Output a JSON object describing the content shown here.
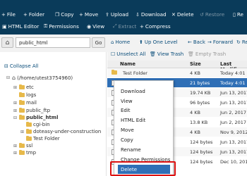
{
  "toolbar": {
    "row1": [
      {
        "icon": "plus-icon",
        "glyph": "+",
        "label": "File",
        "enabled": true
      },
      {
        "icon": "plus-icon",
        "glyph": "+",
        "label": "Folder",
        "enabled": true
      },
      {
        "icon": "copy-icon",
        "glyph": "❐",
        "label": "Copy",
        "enabled": true
      },
      {
        "icon": "move-icon",
        "glyph": "+",
        "label": "Move",
        "enabled": true
      },
      {
        "icon": "upload-icon",
        "glyph": "⇪",
        "label": "Upload",
        "enabled": true
      },
      {
        "icon": "download-icon",
        "glyph": "⇩",
        "label": "Download",
        "enabled": true
      },
      {
        "icon": "delete-icon",
        "glyph": "✕",
        "label": "Delete",
        "enabled": true
      },
      {
        "icon": "restore-icon",
        "glyph": "↺",
        "label": "Restore",
        "enabled": false
      },
      {
        "icon": "rename-icon",
        "glyph": "▯",
        "label": "Re",
        "enabled": true
      }
    ],
    "row2": [
      {
        "icon": "html-editor-icon",
        "glyph": "▣",
        "label": "HTML Editor",
        "enabled": true
      },
      {
        "icon": "key-icon",
        "glyph": "⚿",
        "label": "Permissions",
        "enabled": true
      },
      {
        "icon": "eye-icon",
        "glyph": "◉",
        "label": "View",
        "enabled": true
      },
      {
        "icon": "extract-icon",
        "glyph": "⤢",
        "label": "Extract",
        "enabled": false
      },
      {
        "icon": "compress-icon",
        "glyph": "+",
        "label": "Compress",
        "enabled": true
      }
    ]
  },
  "pathbar": {
    "path_value": "public_html",
    "go_label": "Go"
  },
  "right_toolbar": {
    "row1": [
      {
        "icon": "home-icon",
        "glyph": "⌂",
        "label": "Home",
        "enabled": true
      },
      {
        "icon": "up-level-icon",
        "glyph": "⬆",
        "label": "Up One Level",
        "enabled": true
      },
      {
        "icon": "back-icon",
        "glyph": "←",
        "label": "Back",
        "enabled": true
      },
      {
        "icon": "forward-icon",
        "glyph": "→",
        "label": "Forward",
        "enabled": true
      },
      {
        "icon": "reload-icon",
        "glyph": "↻",
        "label": "Re",
        "enabled": true
      }
    ],
    "row2": [
      {
        "icon": "unselect-icon",
        "glyph": "☐",
        "label": "Unselect All",
        "enabled": true
      },
      {
        "icon": "trash-icon",
        "glyph": "🗑",
        "label": "View Trash",
        "enabled": true
      },
      {
        "icon": "empty-trash-icon",
        "glyph": "🗑",
        "label": "Empty Trash",
        "enabled": false
      }
    ]
  },
  "sidebar": {
    "collapse_label": "Collapse All",
    "root_label": "(/home/utest3754960)",
    "items": [
      {
        "label": "etc",
        "toggle": "+",
        "bold": false
      },
      {
        "label": "logs",
        "toggle": "",
        "bold": false
      },
      {
        "label": "mail",
        "toggle": "+",
        "bold": false
      },
      {
        "label": "public_ftp",
        "toggle": "+",
        "bold": false
      },
      {
        "label": "public_html",
        "toggle": "−",
        "bold": true
      },
      {
        "label": "cgi-bin",
        "toggle": "",
        "bold": false
      },
      {
        "label": "doteasy-under-construction",
        "toggle": "+",
        "bold": false
      },
      {
        "label": "Test Folder",
        "toggle": "",
        "bold": false
      },
      {
        "label": "ssl",
        "toggle": "+",
        "bold": false
      },
      {
        "label": "tmp",
        "toggle": "+",
        "bold": false
      }
    ]
  },
  "file_grid": {
    "headers": {
      "name": "Name",
      "size": "Size",
      "modified": "Last Modifi"
    },
    "rows": [
      {
        "name": "Test Folder",
        "size": "4 KB",
        "modified": "Today 4:01",
        "type": "folder"
      },
      {
        "name": "test.html",
        "size": "21 bytes",
        "modified": "Today 4:01",
        "type": "file"
      },
      {
        "name": "",
        "size": "19.74 KB",
        "modified": "Jun 13, 2017",
        "type": "file"
      },
      {
        "name": "",
        "size": "96 bytes",
        "modified": "Jun 13, 2017",
        "type": "file"
      },
      {
        "name": "",
        "size": "4 KB",
        "modified": "Jun 2, 2017",
        "type": "file"
      },
      {
        "name": "ction",
        "size": "13.8 KB",
        "modified": "Jun 2, 2017",
        "type": "file"
      },
      {
        "name": "ction",
        "size": "4 KB",
        "modified": "Nov 9, 2012",
        "type": "file"
      },
      {
        "name": "",
        "size": "124 bytes",
        "modified": "Jun 13, 2017",
        "type": "file"
      },
      {
        "name": "",
        "size": "124 bytes",
        "modified": "Jun 13, 2017",
        "type": "file"
      },
      {
        "name": "",
        "size": "124 bytes",
        "modified": "Dec 10, 2017",
        "type": "file"
      }
    ]
  },
  "context_menu": {
    "items": [
      "Download",
      "View",
      "Edit",
      "HTML Edit",
      "Move",
      "Copy",
      "Rename",
      "Change Permissions"
    ],
    "delete_label": "Delete"
  }
}
